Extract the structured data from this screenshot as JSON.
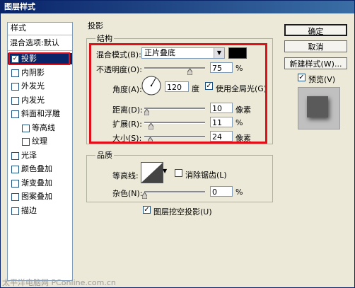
{
  "window": {
    "title": "图层样式"
  },
  "left_panel": {
    "header": "样式",
    "blend_options": "混合选项:默认",
    "items": [
      {
        "label": "投影",
        "checked": true,
        "selected": true,
        "indent": false
      },
      {
        "label": "内阴影",
        "checked": false,
        "selected": false,
        "indent": false
      },
      {
        "label": "外发光",
        "checked": false,
        "selected": false,
        "indent": false
      },
      {
        "label": "内发光",
        "checked": false,
        "selected": false,
        "indent": false
      },
      {
        "label": "斜面和浮雕",
        "checked": false,
        "selected": false,
        "indent": false
      },
      {
        "label": "等高线",
        "checked": false,
        "selected": false,
        "indent": true
      },
      {
        "label": "纹理",
        "checked": false,
        "selected": false,
        "indent": true
      },
      {
        "label": "光泽",
        "checked": false,
        "selected": false,
        "indent": false
      },
      {
        "label": "颜色叠加",
        "checked": false,
        "selected": false,
        "indent": false
      },
      {
        "label": "渐变叠加",
        "checked": false,
        "selected": false,
        "indent": false
      },
      {
        "label": "图案叠加",
        "checked": false,
        "selected": false,
        "indent": false
      },
      {
        "label": "描边",
        "checked": false,
        "selected": false,
        "indent": false
      }
    ]
  },
  "drop_shadow": {
    "title": "投影",
    "structure": {
      "title": "结构",
      "blend_mode_label": "混合模式(B):",
      "blend_mode_value": "正片叠底",
      "shadow_color": "#000000",
      "opacity_label": "不透明度(O):",
      "opacity_value": "75",
      "opacity_unit": "%",
      "opacity_level": 0.75,
      "angle_label": "角度(A):",
      "angle_value": "120",
      "angle_unit": "度",
      "global_light_label": "使用全局光(G)",
      "global_light_checked": true,
      "distance_label": "距离(D):",
      "distance_value": "10",
      "distance_unit": "像素",
      "distance_level": 0.04,
      "spread_label": "扩展(R):",
      "spread_value": "11",
      "spread_unit": "%",
      "spread_level": 0.11,
      "size_label": "大小(S):",
      "size_value": "24",
      "size_unit": "像素",
      "size_level": 0.1
    },
    "quality": {
      "title": "品质",
      "contour_label": "等高线:",
      "antialias_label": "消除锯齿(L)",
      "antialias_checked": false,
      "noise_label": "杂色(N):",
      "noise_value": "0",
      "noise_unit": "%",
      "noise_level": 0
    },
    "knockout_label": "图层挖空投影(U)",
    "knockout_checked": true
  },
  "buttons": {
    "ok": "确定",
    "cancel": "取消",
    "new_style": "新建样式(W)...",
    "preview_label": "预览(V)",
    "preview_checked": true
  },
  "watermark": "太平洋电脑网 PConline.com.cn",
  "colors": {
    "highlight": "#e0101a",
    "selection": "#0a246a"
  }
}
